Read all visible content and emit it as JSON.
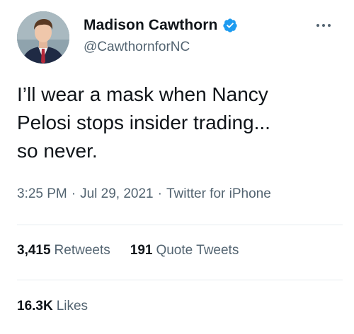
{
  "author": {
    "display_name": "Madison Cawthorn",
    "handle": "@CawthornforNC",
    "verified": true,
    "avatar_icon": "profile-photo"
  },
  "tweet": {
    "text": "I’ll wear a mask when Nancy\nPelosi stops insider trading...\nso never."
  },
  "meta": {
    "time": "3:25 PM",
    "separator": "·",
    "date": "Jul 29, 2021",
    "source": "Twitter for iPhone"
  },
  "stats": {
    "retweets_count": "3,415",
    "retweets_label": "Retweets",
    "quote_tweets_count": "191",
    "quote_tweets_label": "Quote Tweets",
    "likes_count": "16.3K",
    "likes_label": "Likes"
  },
  "colors": {
    "text_primary": "#0f1419",
    "text_secondary": "#536471",
    "verified_blue": "#1d9bf0",
    "divider": "#e6ecf0"
  }
}
